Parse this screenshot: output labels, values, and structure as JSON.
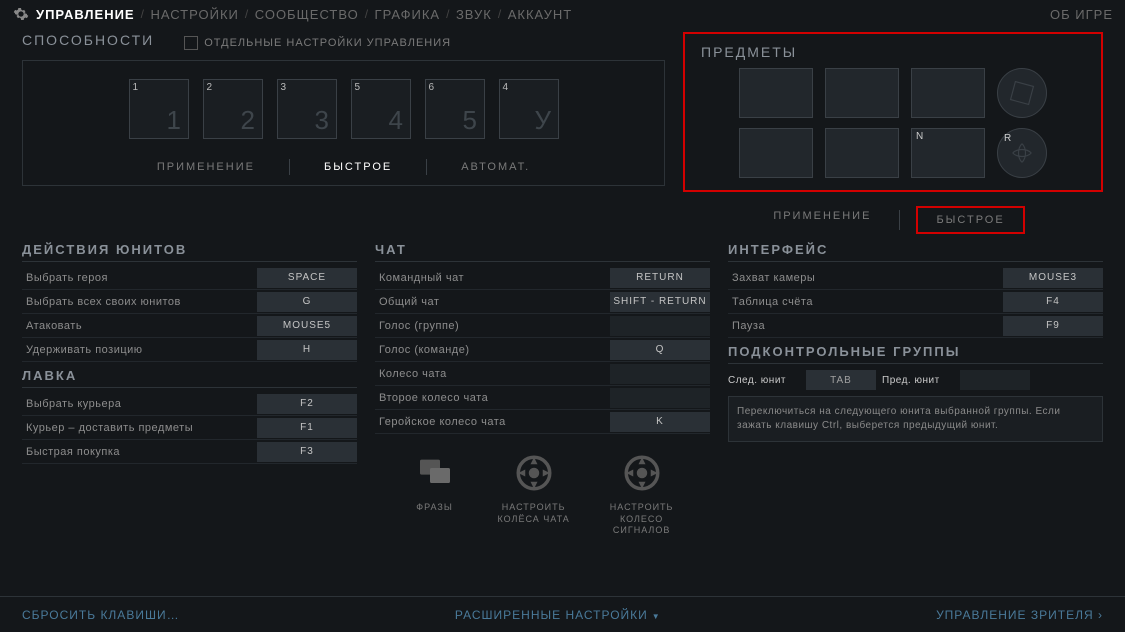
{
  "topnav": {
    "tabs": [
      "УПРАВЛЕНИЕ",
      "НАСТРОЙКИ",
      "СООБЩЕСТВО",
      "ГРАФИКА",
      "ЗВУК",
      "АККАУНТ"
    ],
    "about": "ОБ ИГРЕ"
  },
  "abilities": {
    "title": "СПОСОБНОСТИ",
    "checkbox_label": "ОТДЕЛЬНЫЕ НАСТРОЙКИ УПРАВЛЕНИЯ",
    "slots": [
      {
        "corner": "1",
        "big": "1"
      },
      {
        "corner": "2",
        "big": "2"
      },
      {
        "corner": "3",
        "big": "3"
      },
      {
        "corner": "5",
        "big": "4"
      },
      {
        "corner": "6",
        "big": "5"
      },
      {
        "corner": "4",
        "big": "У"
      }
    ],
    "modes": [
      "ПРИМЕНЕНИЕ",
      "БЫСТРОЕ",
      "АВТОМАТ."
    ],
    "active_mode": 1
  },
  "items": {
    "title": "ПРЕДМЕТЫ",
    "row1": [
      {
        "key": ""
      },
      {
        "key": ""
      },
      {
        "key": ""
      }
    ],
    "row2": [
      {
        "key": ""
      },
      {
        "key": ""
      },
      {
        "key": "N"
      }
    ],
    "round1_key": "",
    "round2_key": "R",
    "modes": [
      "ПРИМЕНЕНИЕ",
      "БЫСТРОЕ"
    ],
    "active_mode": 1
  },
  "unit_actions": {
    "title": "ДЕЙСТВИЯ ЮНИТОВ",
    "rows": [
      {
        "label": "Выбрать героя",
        "key": "SPACE"
      },
      {
        "label": "Выбрать всех своих юнитов",
        "key": "G"
      },
      {
        "label": "Атаковать",
        "key": "MOUSE5"
      },
      {
        "label": "Удерживать позицию",
        "key": "H"
      }
    ]
  },
  "shop": {
    "title": "ЛАВКА",
    "rows": [
      {
        "label": "Выбрать курьера",
        "key": "F2"
      },
      {
        "label": "Курьер – доставить предметы",
        "key": "F1"
      },
      {
        "label": "Быстрая покупка",
        "key": "F3"
      }
    ]
  },
  "chat": {
    "title": "ЧАТ",
    "rows": [
      {
        "label": "Командный чат",
        "key": "RETURN"
      },
      {
        "label": "Общий чат",
        "key": "SHIFT - RETURN"
      },
      {
        "label": "Голос (группе)",
        "key": ""
      },
      {
        "label": "Голос (команде)",
        "key": "Q"
      },
      {
        "label": "Колесо чата",
        "key": ""
      },
      {
        "label": "Второе колесо чата",
        "key": ""
      },
      {
        "label": "Геройское колесо чата",
        "key": "K"
      }
    ],
    "icons": [
      {
        "label": "ФРАЗЫ"
      },
      {
        "label": "НАСТРОИТЬ\nКОЛЁСА ЧАТА"
      },
      {
        "label": "НАСТРОИТЬ\nКОЛЕСО\nСИГНАЛОВ"
      }
    ]
  },
  "interface": {
    "title": "ИНТЕРФЕЙС",
    "rows": [
      {
        "label": "Захват камеры",
        "key": "MOUSE3"
      },
      {
        "label": "Таблица счёта",
        "key": "F4"
      },
      {
        "label": "Пауза",
        "key": "F9"
      }
    ]
  },
  "control_groups": {
    "title": "ПОДКОНТРОЛЬНЫЕ ГРУППЫ",
    "next_label": "След. юнит",
    "next_key": "TAB",
    "prev_label": "Пред. юнит",
    "prev_key": "",
    "hint": "Переключиться на следующего юнита выбранной группы. Если зажать клавишу Ctrl, выберется предыдущий юнит."
  },
  "footer": {
    "reset": "СБРОСИТЬ КЛАВИШИ…",
    "advanced": "РАСШИРЕННЫЕ НАСТРОЙКИ",
    "spectator": "УПРАВЛЕНИЕ ЗРИТЕЛЯ"
  }
}
